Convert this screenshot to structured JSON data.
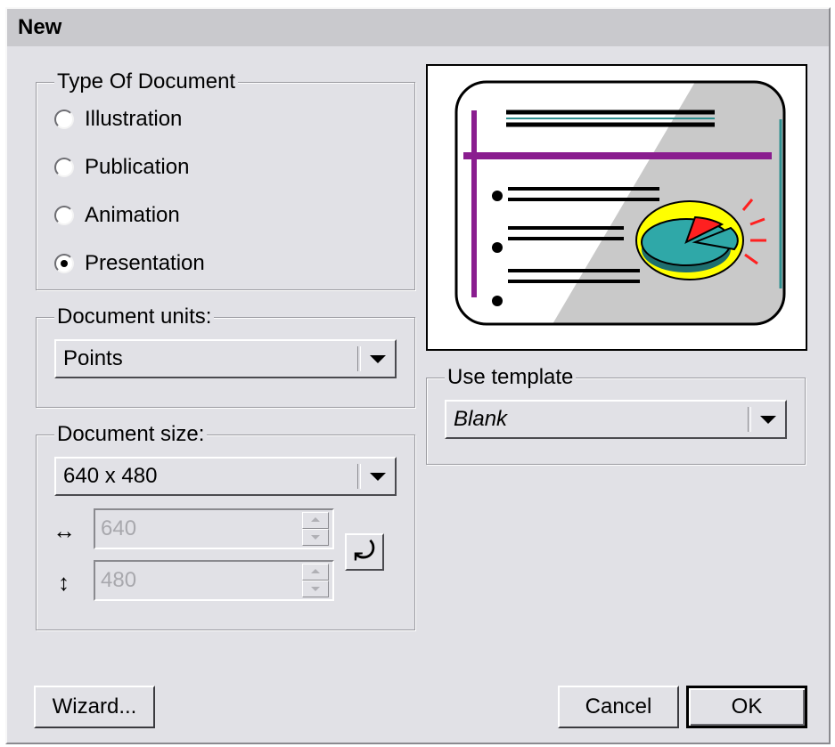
{
  "dialog": {
    "title": "New"
  },
  "type_of_document": {
    "legend": "Type Of Document",
    "options": [
      {
        "label": "Illustration",
        "selected": false
      },
      {
        "label": "Publication",
        "selected": false
      },
      {
        "label": "Animation",
        "selected": false
      },
      {
        "label": "Presentation",
        "selected": true
      }
    ]
  },
  "document_units": {
    "legend": "Document units:",
    "value": "Points"
  },
  "document_size": {
    "legend": "Document size:",
    "value": "640 x 480",
    "width": "640",
    "height": "480",
    "width_icon": "horizontal-arrows-icon",
    "height_icon": "vertical-arrows-icon",
    "swap_icon": "rotate-arrow-icon"
  },
  "preview": {
    "icon": "presentation-slide-preview"
  },
  "use_template": {
    "legend": "Use template",
    "value": "Blank"
  },
  "buttons": {
    "wizard": "Wizard...",
    "cancel": "Cancel",
    "ok": "OK"
  }
}
